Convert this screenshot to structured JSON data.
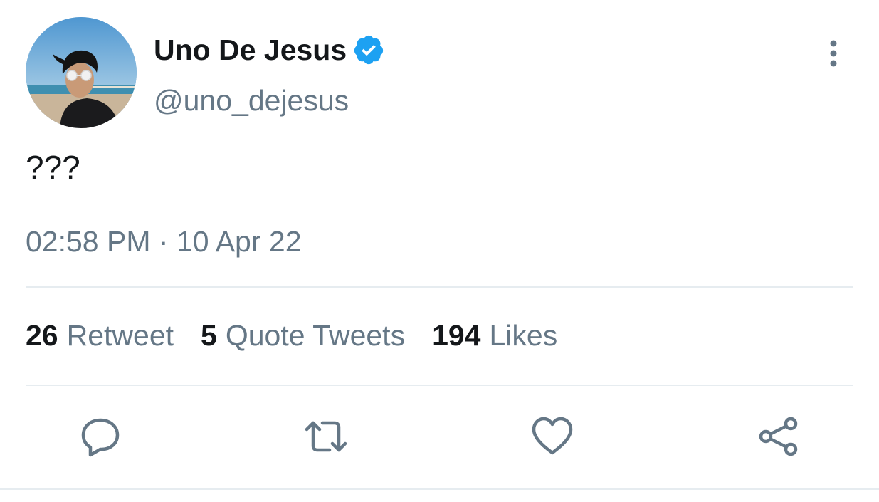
{
  "author": {
    "display_name": "Uno De Jesus",
    "handle": "@uno_dejesus",
    "verified": true,
    "verified_color": "#1da1f2"
  },
  "tweet": {
    "text": "???",
    "time": "02:58 PM",
    "separator": "·",
    "date": "10 Apr 22"
  },
  "stats": {
    "retweets_count": "26",
    "retweets_label": "Retweet",
    "quotes_count": "5",
    "quotes_label": "Quote Tweets",
    "likes_count": "194",
    "likes_label": "Likes"
  },
  "icons": {
    "more": "more-vertical-icon",
    "reply": "reply-icon",
    "retweet": "retweet-icon",
    "like": "heart-icon",
    "share": "share-icon"
  },
  "colors": {
    "text_primary": "#14171a",
    "text_secondary": "#657786",
    "divider": "#e6ecf0"
  }
}
